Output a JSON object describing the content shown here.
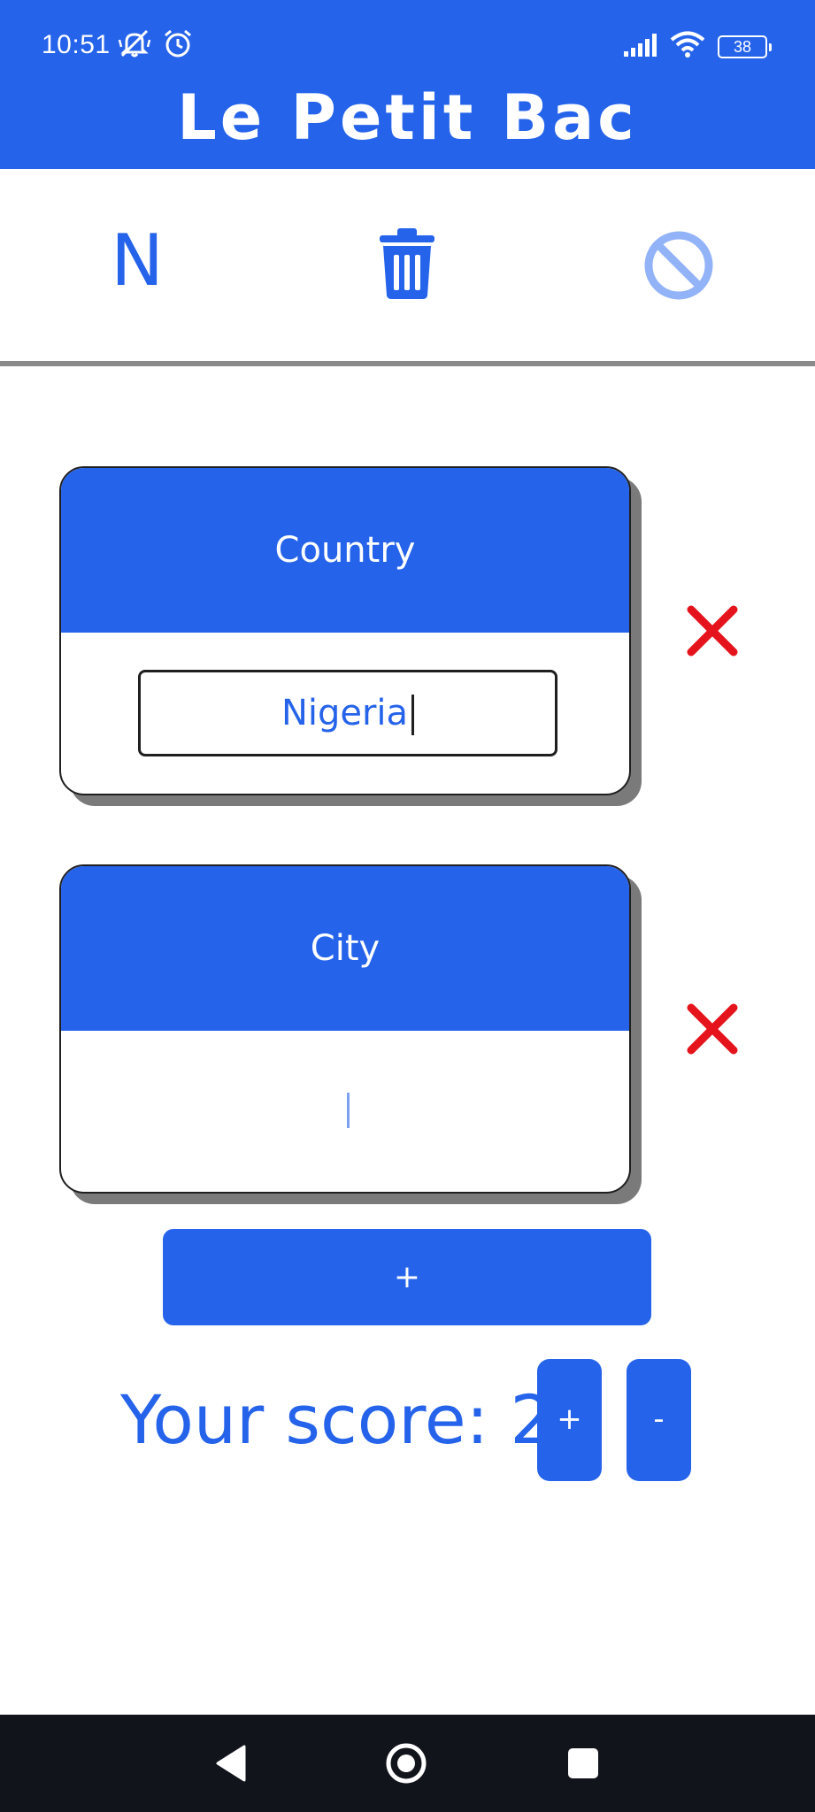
{
  "status_bar": {
    "time": "10:51",
    "battery": "38",
    "icons": [
      "mute-icon",
      "alarm-icon",
      "signal-icon",
      "wifi-icon",
      "battery-icon"
    ]
  },
  "header": {
    "title": "Le Petit Bac"
  },
  "toolbar": {
    "letter": "N",
    "icons": [
      "delete-icon",
      "disabled-icon"
    ]
  },
  "categories": [
    {
      "label": "Country",
      "answer": "Nigeria"
    },
    {
      "label": "City",
      "answer": ""
    }
  ],
  "add_category": {
    "label": "+"
  },
  "score": {
    "label": "Your score:",
    "value": "2",
    "increment_label": "+",
    "decrement_label": "-"
  },
  "colors": {
    "primary": "#2563EB",
    "remove": "#E5131B",
    "disabled_icon": "#93B3F8",
    "nav_bar": "#12141B"
  },
  "nav_bar": {
    "icons": [
      "back-icon",
      "home-icon",
      "recents-icon"
    ]
  }
}
